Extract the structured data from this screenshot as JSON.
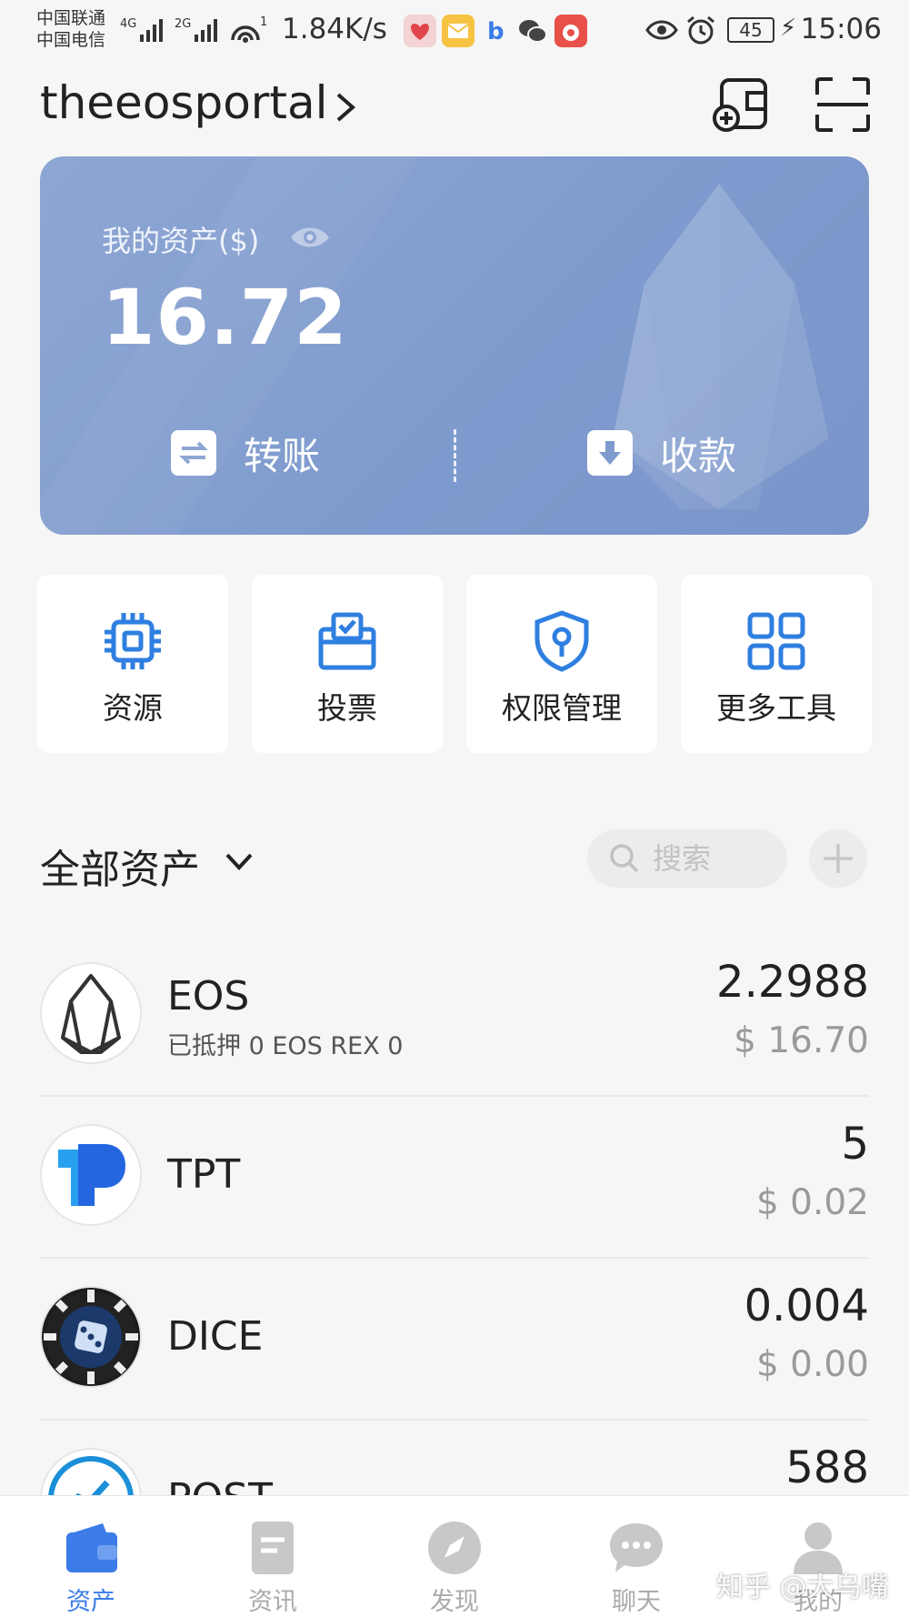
{
  "status_bar": {
    "carrier_1": "中国联通",
    "carrier_2": "中国电信",
    "net_1": "4G",
    "net_2": "2G",
    "hotspot_count": "1",
    "speed": "1.84K/s",
    "battery": "45",
    "time": "15:06"
  },
  "header": {
    "account_name": "theeosportal",
    "icons": [
      "chevron-right-icon",
      "add-wallet-icon",
      "scan-icon"
    ]
  },
  "asset_card": {
    "label": "我的资产($)",
    "total": "16.72",
    "transfer_label": "转账",
    "receive_label": "收款",
    "colors": {
      "card": "#809cce"
    }
  },
  "tools": [
    {
      "label": "资源",
      "icon": "chip-icon"
    },
    {
      "label": "投票",
      "icon": "ballot-box-icon"
    },
    {
      "label": "权限管理",
      "icon": "shield-key-icon"
    },
    {
      "label": "更多工具",
      "icon": "grid-icon"
    }
  ],
  "section": {
    "title": "全部资产",
    "search_placeholder": "搜索"
  },
  "assets": [
    {
      "symbol": "EOS",
      "detail": "已抵押 0 EOS    REX 0",
      "amount": "2.2988",
      "usd": "$ 16.70"
    },
    {
      "symbol": "TPT",
      "detail": "",
      "amount": "5",
      "usd": "$ 0.02"
    },
    {
      "symbol": "DICE",
      "detail": "",
      "amount": "0.004",
      "usd": "$ 0.00"
    },
    {
      "symbol": "POST",
      "detail": "",
      "amount": "588",
      "usd": ""
    }
  ],
  "tabbar": [
    {
      "label": "资产",
      "active": true
    },
    {
      "label": "资讯",
      "active": false
    },
    {
      "label": "发现",
      "active": false
    },
    {
      "label": "聊天",
      "active": false
    },
    {
      "label": "我的",
      "active": false
    }
  ],
  "watermark": "知乎 @大乌嘴",
  "colors": {
    "accent": "#3b7ce8",
    "icon_blue": "#2f7fe0"
  }
}
